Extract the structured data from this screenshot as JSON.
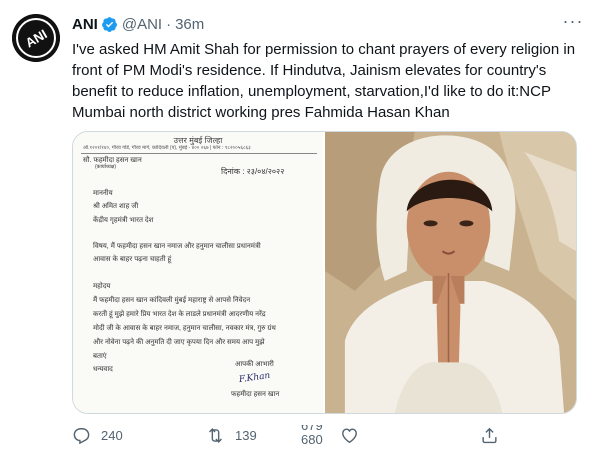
{
  "tweet": {
    "name": "ANI",
    "handle": "@ANI",
    "separator": "·",
    "time": "36m",
    "text": "I've asked HM Amit Shah for permission to chant prayers of every religion in front of PM Modi's residence. If Hindutva, Jainism elevates for country's benefit to reduce inflation, unemployment, starvation,I'd like to do it:NCP Mumbai north district working pres Fahmida Hasan Khan",
    "avatar_label": "ANI",
    "more_label": "···"
  },
  "letter": {
    "heading": "उत्तर मुंबई जिल्हा",
    "address": "ऑ.१२०१/१४०, गौरव गोर्ड, गौरव मार्ग, कांदिवली (प), मुंबई - ४०० ०६७ | फोन : ९८२००५६८६३",
    "from": "सौ. फहमीदा हसन खान",
    "from_title": "(कार्याध्यक्ष)",
    "date": "दिनांक : २३/०४/२०२२",
    "to_1": "माननीय",
    "to_2": "श्री अमित शाह जी",
    "to_3": "केंद्रीय गृहमंत्री भारत देश",
    "subject_1": "विषय, मैं फहमीदा हसन खान नमाज और हनुमान चालीसा प्रधानमंत्री",
    "subject_2": "आवास के बाहर पढ़ना चाहती हूं",
    "salutation": "महोदय",
    "body_1": "मैं फहमीदा हसन खान कांदिवली मुंबई महाराष्ट्र से आपसे निवेदन",
    "body_2": "करती हूं मुझे हमारे प्रिय भारत देश के लाडले प्रधानमंत्री आदरणीय नरेंद्र",
    "body_3": "मोदी जी के आवास के बाहर नमाज, हनुमान चालीसा, नवकार मंत्र, गुरु ग्रंथ",
    "body_4": "और नोवेना पढ़ने की अनुमति दी जाए कृपया दिन और समय आप मुझे",
    "body_5": "बताएं",
    "thanks": "धन्यवाद",
    "yours": "आपकी आभारी",
    "signature": "F.Khan",
    "signer": "फहमीदा हसन खान"
  },
  "actions": {
    "replies": "240",
    "retweets": "139",
    "likes_top": "679",
    "likes_bottom": "680"
  },
  "colors": {
    "text": "#0f1419",
    "muted": "#536471",
    "verified": "#1d9bf0",
    "border": "#cfd9de"
  },
  "icons": [
    "verified-badge-icon",
    "more-icon",
    "reply-icon",
    "retweet-icon",
    "like-icon",
    "share-icon"
  ]
}
